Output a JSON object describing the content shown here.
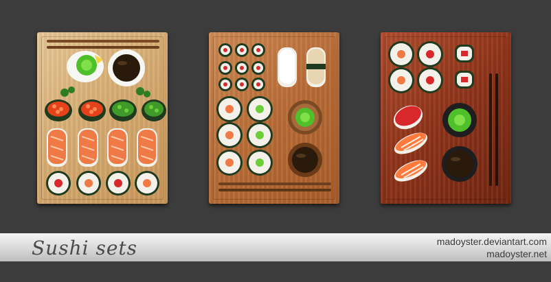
{
  "footer": {
    "title": "Sushi  sets",
    "site_deviantart": "madoyster.deviantart.com",
    "site_net": "madoyster.net"
  },
  "sets": [
    {
      "name": "sushi-set-light-board",
      "board_color": "#d7ad73"
    },
    {
      "name": "sushi-set-medium-board",
      "board_color": "#b86c36"
    },
    {
      "name": "sushi-set-red-board",
      "board_color": "#8d3219"
    }
  ],
  "colors": {
    "background": "#3c3c3c",
    "wasabi": "#4fbf2a",
    "salmon": "#f07a45",
    "nori": "#1f3a1e",
    "rice": "#f4f1ea",
    "soy": "#2a1a0c"
  },
  "icons": [
    "chopsticks-icon",
    "wasabi-icon",
    "soy-sauce-icon",
    "roe-sushi-icon",
    "seaweed-salad-icon",
    "salmon-nigiri-icon",
    "maki-roll-icon",
    "shrimp-nigiri-icon",
    "tuna-nigiri-icon",
    "squid-nigiri-icon"
  ]
}
